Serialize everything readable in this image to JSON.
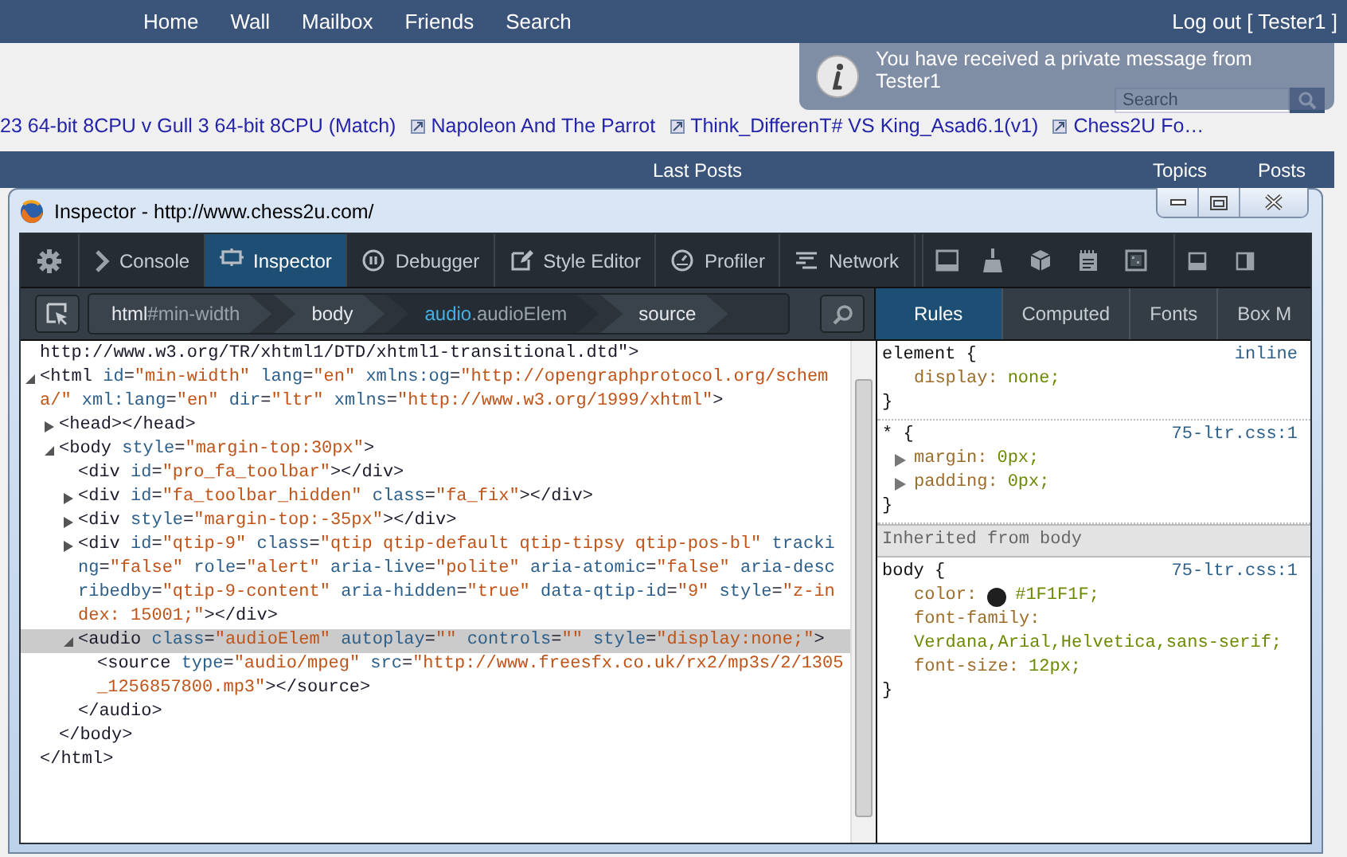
{
  "nav": {
    "links": [
      "Home",
      "Wall",
      "Mailbox",
      "Friends",
      "Search"
    ],
    "account": "Log out [ Tester1 ]"
  },
  "search": {
    "placeholder": "Search"
  },
  "notification": {
    "message": "You have received a private message from Tester1"
  },
  "ticker": [
    "23 64-bit 8CPU v Gull 3 64-bit 8CPU (Match)",
    "Napoleon And The Parrot",
    "Think_DifferenT# VS King_Asad6.1(v1)",
    "Chess2U Fo…"
  ],
  "posts_header": {
    "title": "Last Posts",
    "columns": [
      "Topics",
      "Posts"
    ]
  },
  "inspector": {
    "title": "Inspector - http://www.chess2u.com/",
    "tools": [
      {
        "label": "Console",
        "selected": false
      },
      {
        "label": "Inspector",
        "selected": true
      },
      {
        "label": "Debugger",
        "selected": false
      },
      {
        "label": "Style Editor",
        "selected": false
      },
      {
        "label": "Profiler",
        "selected": false
      },
      {
        "label": "Network",
        "selected": false
      }
    ],
    "breadcrumbs": [
      {
        "tag": "html",
        "detail": "#min-width",
        "selected": false
      },
      {
        "tag": "body",
        "selected": false
      },
      {
        "tag": "audio",
        "detail": ".audioElem",
        "selected": true
      },
      {
        "tag": "source",
        "selected": false
      }
    ],
    "markup": [
      {
        "text": "http://www.w3.org/TR/xhtml1/DTD/xhtml1-transitional.dtd\">",
        "selected": false
      },
      {
        "text": "<html id=\"min-width\" lang=\"en\" xmlns:og=\"http://opengraphprotocol.org/schema/\" xml:lang=\"en\" dir=\"ltr\" xmlns=\"http://www.w3.org/1999/xhtml\">",
        "expanded": true,
        "selected": false,
        "close": "</html>",
        "children": [
          {
            "text": "<head></head>",
            "expanded": false,
            "selected": false
          },
          {
            "text": "<body style=\"margin-top:30px\">",
            "expanded": true,
            "selected": false,
            "close": "</body>",
            "children": [
              {
                "text": "<div id=\"pro_fa_toolbar\"></div>",
                "selected": false
              },
              {
                "text": "<div id=\"fa_toolbar_hidden\" class=\"fa_fix\"></div>",
                "expanded": false,
                "selected": false
              },
              {
                "text": "<div style=\"margin-top:-35px\"></div>",
                "expanded": false,
                "selected": false
              },
              {
                "text": "<div id=\"qtip-9\" class=\"qtip qtip-default qtip-tipsy qtip-pos-bl\" tracking=\"false\" role=\"alert\" aria-live=\"polite\" aria-atomic=\"false\" aria-describedby=\"qtip-9-content\" aria-hidden=\"true\" data-qtip-id=\"9\" style=\"z-index: 15001;\"></div>",
                "expanded": false,
                "selected": false
              },
              {
                "text": "<audio class=\"audioElem\" autoplay=\"\" controls=\"\" style=\"display:none;\">",
                "expanded": true,
                "selected": true,
                "close": "</audio>",
                "children": [
                  {
                    "text": "<source type=\"audio/mpeg\" src=\"http://www.freesfx.co.uk/rx2/mp3s/2/1305_1256857800.mp3\"></source>",
                    "selected": false
                  }
                ]
              }
            ]
          }
        ]
      }
    ],
    "sidebar_tabs": [
      {
        "label": "Rules",
        "selected": true
      },
      {
        "label": "Computed",
        "selected": false
      },
      {
        "label": "Fonts",
        "selected": false
      },
      {
        "label": "Box M",
        "selected": false
      }
    ],
    "rules": [
      {
        "kind": "rule",
        "selector": "element {",
        "source": "inline",
        "close": "}",
        "properties": [
          {
            "name": "display:",
            "value": "none;"
          }
        ]
      },
      {
        "kind": "rule",
        "selector": "* {",
        "source": "75-ltr.css:1",
        "close": "}",
        "properties": [
          {
            "name": "margin:",
            "value": "0px;",
            "expanded": false
          },
          {
            "name": "padding:",
            "value": "0px;",
            "expanded": false
          }
        ]
      },
      {
        "kind": "header",
        "text": "Inherited from body"
      },
      {
        "kind": "rule",
        "selector": "body {",
        "source": "75-ltr.css:1",
        "close": "}",
        "properties": [
          {
            "name": "color:",
            "value": "#1F1F1F;",
            "color": "#1f1f1f"
          },
          {
            "name": "font-family:",
            "value": "Verdana,Arial,Helvetica,sans-serif;"
          },
          {
            "name": "font-size:",
            "value": "12px;"
          }
        ]
      }
    ]
  }
}
